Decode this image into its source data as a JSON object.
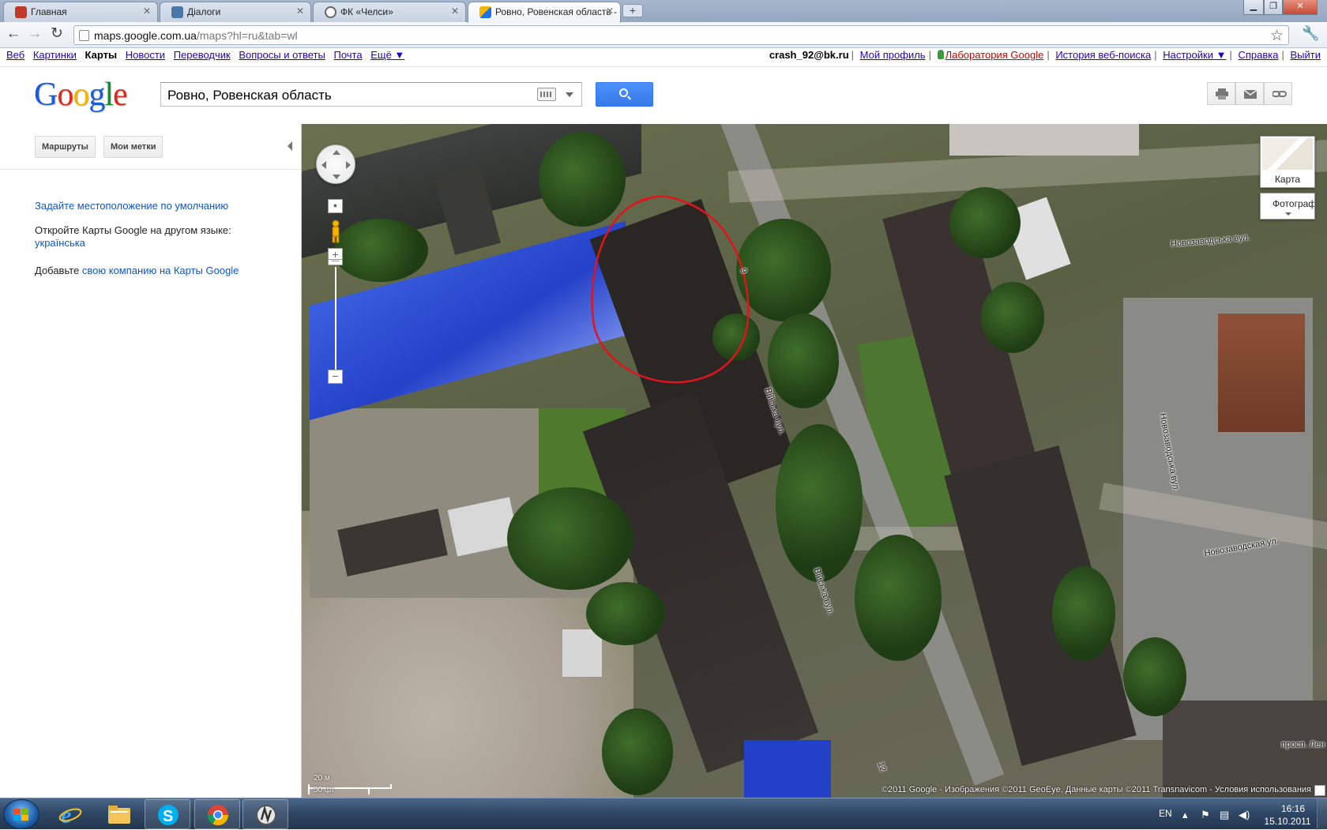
{
  "browser": {
    "tabs": [
      {
        "title": "Главная",
        "icon": "vk-icon",
        "color": "#c0392b"
      },
      {
        "title": "Діалоги",
        "icon": "vk-icon",
        "color": "#4a76a8"
      },
      {
        "title": "ФК «Челси»",
        "icon": "wiki-icon",
        "color": "#666666"
      },
      {
        "title": "Ровно, Ровенская область - Google Карты",
        "icon": "google-maps-icon",
        "color": "#f4b400"
      }
    ],
    "new_tab_label": "+",
    "url_host": "maps.google.com.ua",
    "url_path": "/maps?hl=ru&tab=wl"
  },
  "gbar": {
    "left_links": [
      "Веб",
      "Картинки",
      "Карты",
      "Новости",
      "Переводчик",
      "Вопросы и ответы",
      "Почта",
      "Ещё ▼"
    ],
    "current": "Карты",
    "user": "crash_92@bk.ru",
    "right_links": [
      "Мой профиль",
      "Лаборатория Google",
      "История веб-поиска",
      "Настройки ▼",
      "Справка",
      "Выйти"
    ]
  },
  "header": {
    "logo_letters": [
      "G",
      "o",
      "o",
      "g",
      "l",
      "e"
    ],
    "logo_colors": [
      "#1a5bd6",
      "#d62d20",
      "#f4b400",
      "#1a5bd6",
      "#138a36",
      "#d62d20"
    ],
    "search_value": "Ровно, Ровенская область"
  },
  "leftpanel": {
    "routes_button": "Маршруты",
    "mymaps_button": "Мои метки",
    "set_location_link": "Задайте местоположение по умолчанию",
    "other_lang_text": "Откройте Карты Google на другом языке:",
    "other_lang_link": "українська",
    "add_business_prefix": "Добавьте",
    "add_business_link": "свою компанию на Карты Google"
  },
  "map": {
    "map_type_label": "Карта",
    "photo_type_label": "Фотографии",
    "street_labels": [
      {
        "text": "Новозаводська вул.",
        "rotate": -5
      },
      {
        "text": "Новозаводська вул.",
        "rotate": 80
      },
      {
        "text": "Новозаводская ул.",
        "rotate": -10
      },
      {
        "text": "Війська вул.",
        "rotate": 72
      },
      {
        "text": "Війська вул.",
        "rotate": 72
      },
      {
        "text": "просп. Лен",
        "rotate": 0
      },
      {
        "text": "9",
        "rotate": 70
      },
      {
        "text": "12",
        "rotate": 70
      }
    ],
    "scale_metric": "20 м",
    "scale_imperial": "50 фт",
    "copyright": "©2011 Google - Изображения ©2011 GeoEye, Данные карты ©2011 Transnavicom - Условия использования"
  },
  "taskbar": {
    "language": "EN",
    "time": "16:16",
    "date": "15.10.2011",
    "apps": [
      "ie-icon",
      "explorer-icon",
      "skype-icon",
      "chrome-icon",
      "winamp-icon"
    ]
  }
}
